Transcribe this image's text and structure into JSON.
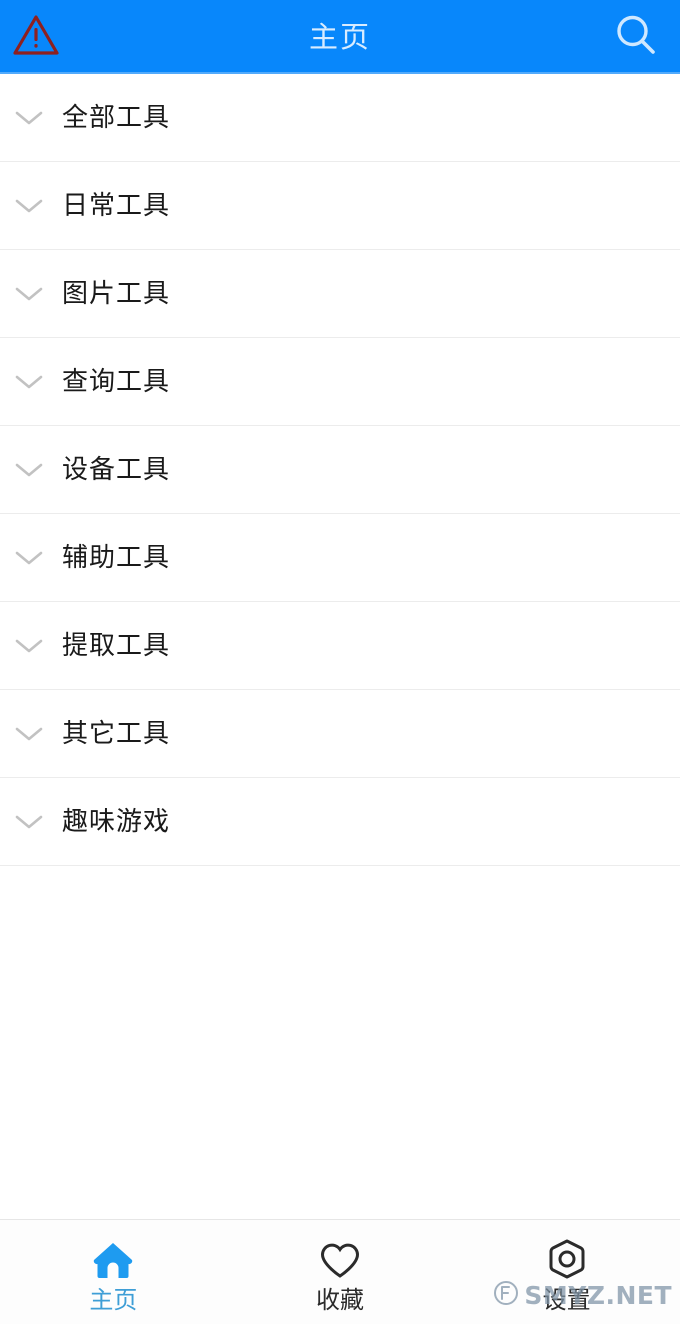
{
  "header": {
    "title": "主页",
    "warning_icon": "warning-triangle-icon",
    "search_icon": "search-icon",
    "background_color": "#0887fb",
    "title_color": "#d9ecff"
  },
  "list": {
    "chevron_icon": "chevron-down-icon",
    "items": [
      {
        "label": "全部工具",
        "expanded": false
      },
      {
        "label": "日常工具",
        "expanded": false
      },
      {
        "label": "图片工具",
        "expanded": false
      },
      {
        "label": "查询工具",
        "expanded": false
      },
      {
        "label": "设备工具",
        "expanded": false
      },
      {
        "label": "辅助工具",
        "expanded": false
      },
      {
        "label": "提取工具",
        "expanded": false
      },
      {
        "label": "其它工具",
        "expanded": false
      },
      {
        "label": "趣味游戏",
        "expanded": false
      }
    ]
  },
  "tabbar": {
    "active_color": "#3e9ed6",
    "inactive_color": "#2b2b2b",
    "tabs": [
      {
        "label": "主页",
        "icon": "home-icon",
        "active": true
      },
      {
        "label": "收藏",
        "icon": "heart-icon",
        "active": false
      },
      {
        "label": "设置",
        "icon": "gear-nut-icon",
        "active": false
      }
    ]
  },
  "watermark": {
    "text": "SMYZ.NET",
    "color": "#7f93a6"
  }
}
